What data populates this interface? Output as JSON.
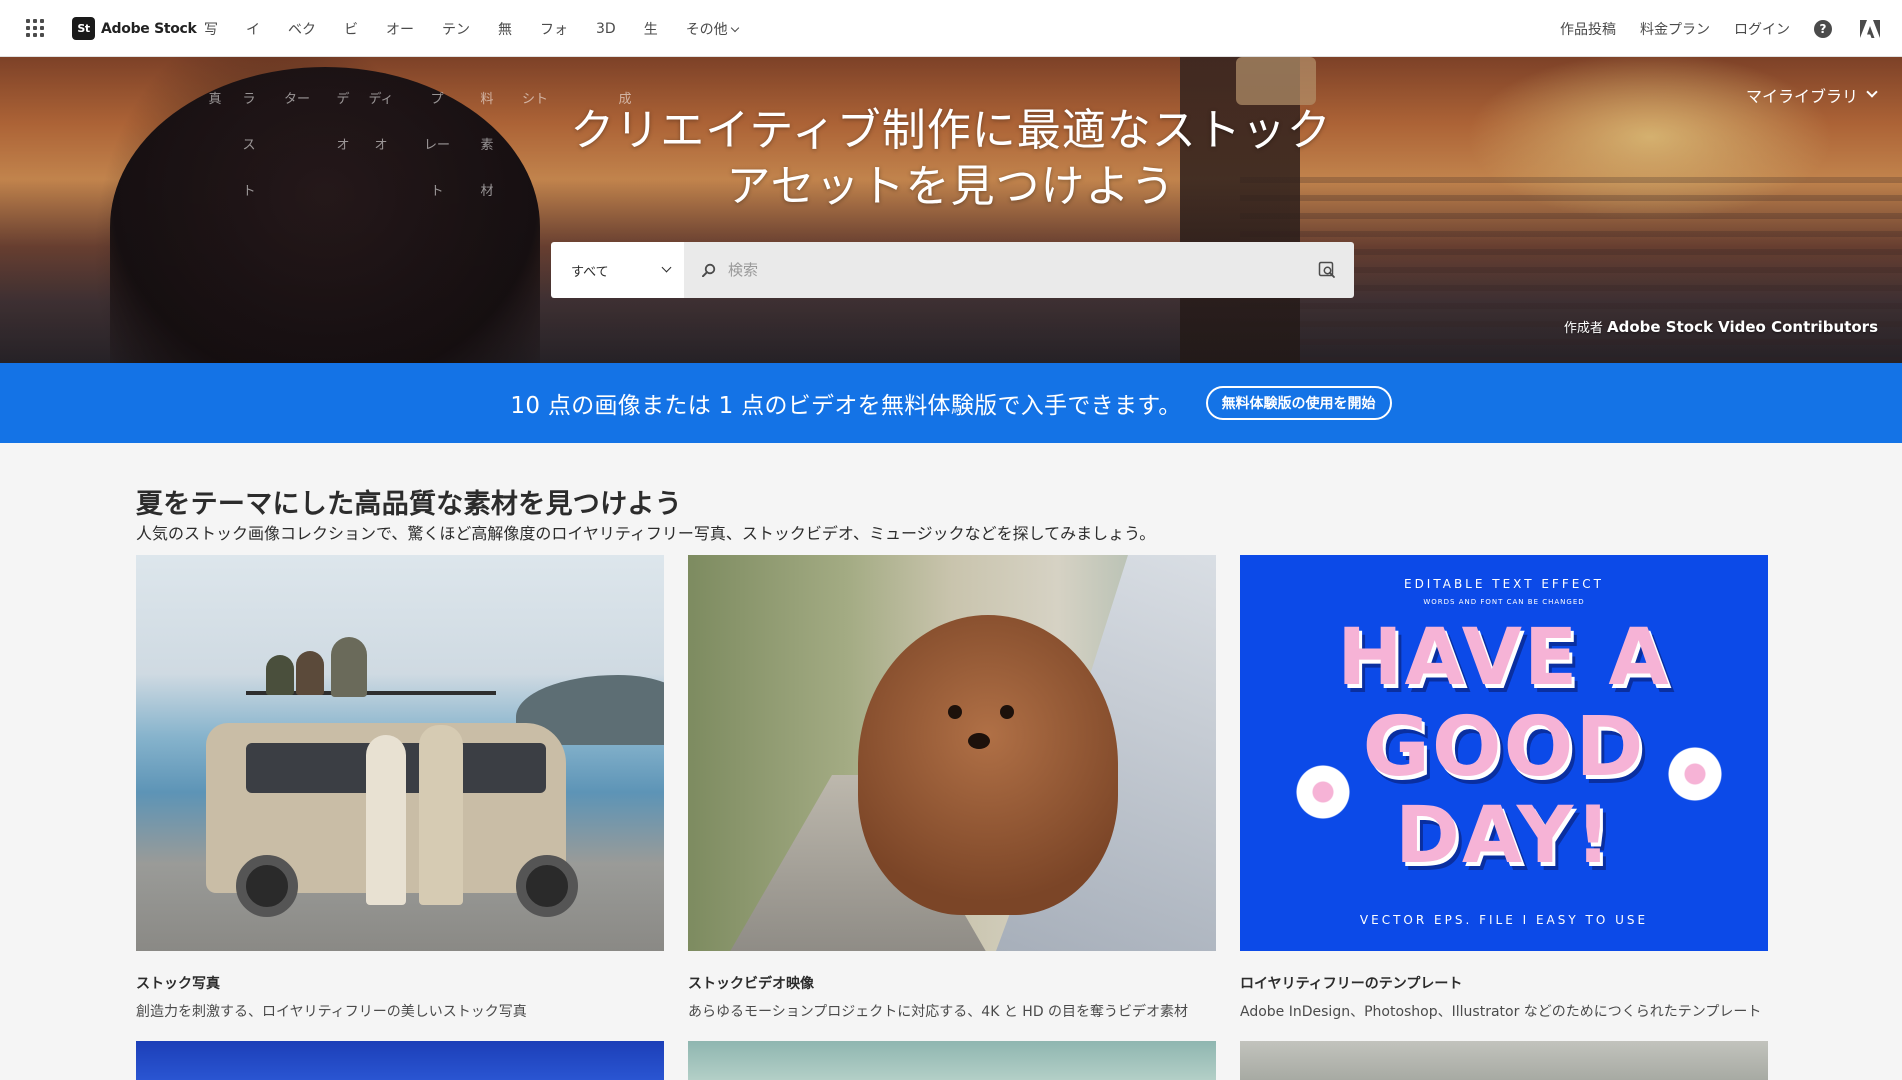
{
  "nav": {
    "brand_logo": "St",
    "brand_name": "Adobe Stock",
    "links": [
      "写",
      "イ",
      "ベク",
      "ビ",
      "オー",
      "テン",
      "無",
      "フォ",
      "3D",
      "生",
      "その他"
    ],
    "right_links": [
      "作品投稿",
      "料金プラン",
      "ログイン"
    ],
    "help_glyph": "?"
  },
  "hero": {
    "title_line1": "クリエイティブ制作に最適なストック",
    "title_line2": "アセットを見つけよう",
    "my_library": "マイライブラリ",
    "ghost_menu": [
      [
        "真",
        "",
        ""
      ],
      [
        "ラ",
        "ス",
        "ト"
      ],
      [
        "ター",
        "",
        ""
      ],
      [
        "デ",
        "オ",
        ""
      ],
      [
        "ディ",
        "オ",
        ""
      ],
      [
        "プ",
        "レー",
        "ト"
      ],
      [
        "料",
        "素",
        "材"
      ],
      [
        "シト",
        "",
        ""
      ],
      [
        "",
        "",
        ""
      ],
      [
        "成",
        "",
        ""
      ]
    ],
    "search": {
      "category": "すべて",
      "placeholder": "検索"
    },
    "credit_prefix": "作成者",
    "credit_name": "Adobe Stock Video Contributors"
  },
  "promo": {
    "text": "10 点の画像または 1 点のビデオを無料体験版で入手できます。",
    "button": "無料体験版の使用を開始"
  },
  "section": {
    "title": "夏をテーマにした高品質な素材を見つけよう",
    "subtitle": "人気のストック画像コレクションで、驚くほど高解像度のロイヤリティフリー写真、ストックビデオ、ミュージックなどを探してみましょう。"
  },
  "cards": [
    {
      "title": "ストック写真",
      "desc": "創造力を刺激する、ロイヤリティフリーの美しいストック写真"
    },
    {
      "title": "ストックビデオ映像",
      "desc": "あらゆるモーションプロジェクトに対応する、4K と HD の目を奪うビデオ素材"
    },
    {
      "title": "ロイヤリティフリーのテンプレート",
      "desc": "Adobe InDesign、Photoshop、Illustrator などのためにつくられたテンプレート"
    }
  ],
  "template_art": {
    "top": "EDITABLE TEXT EFFECT",
    "top_small": "WORDS AND FONT CAN BE CHANGED",
    "line1": "HAVE A",
    "line2": "GOOD",
    "line3": "DAY!",
    "bottom": "VECTOR EPS. FILE   I   EASY TO USE"
  },
  "colors": {
    "promo_blue": "#1473e6",
    "template_blue": "#0c4ae8",
    "template_pink": "#f6b3d6"
  },
  "icons": [
    "apps-grid-icon",
    "search-icon",
    "visual-search-icon",
    "help-icon",
    "adobe-logo-icon",
    "chevron-down-icon"
  ]
}
